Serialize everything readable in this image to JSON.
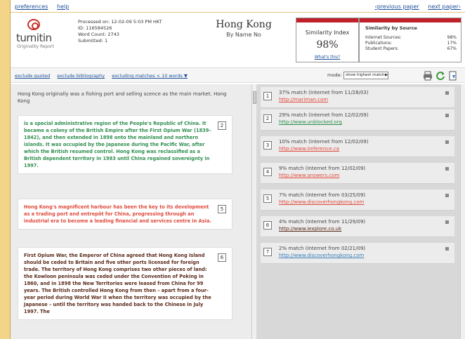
{
  "topbar": {
    "links": [
      "preferences",
      "help"
    ],
    "nav": [
      "‹previous paper",
      "next paper›"
    ]
  },
  "header": {
    "logo_text": "turnitin",
    "logo_sub": "Originality Report",
    "processed": "Processed on: 12-02-09 5:03 PM HKT",
    "id": "ID: 116584526",
    "word_count": "Word Count: 2743",
    "submitted": "Submitted: 1",
    "title": "Hong Kong",
    "author": "By Name No"
  },
  "similarity_index": {
    "label": "Similarity Index",
    "value": "98%",
    "whats_this": "What's this?"
  },
  "similarity_by_source": {
    "heading": "Similarity by Source",
    "rows": [
      {
        "label": "Internet Sources:",
        "value": "98%"
      },
      {
        "label": "Publications:",
        "value": "17%"
      },
      {
        "label": "Student Papers:",
        "value": "67%"
      }
    ]
  },
  "toolbar": {
    "links": [
      "exclude quoted",
      "exclude bibliography",
      "excluding matches < 10 words ▼"
    ],
    "mode_label": "mode:",
    "mode_value": "show highest matches together"
  },
  "document": {
    "intro": "Hong Kong originally was a fishing port and selling scence as the main market. Hong Kong",
    "blocks": [
      {
        "num": "2",
        "color": "#2e8f4f",
        "text": "is a special administrative region of the People's Republic of China. It became a colony of the British Empire after the First Opium War (1839–1842), and then extended in 1898 onto the mainland and northern islands. It was occupied by the Japanese during the Pacific War, after which the British resumed control. Hong Kong was reclassified as a British dependent territory in 1983 until China regained sovereignty in 1997."
      },
      {
        "num": "5",
        "color": "#e04a3c",
        "text": "Hong Kong's magnificent harbour has been the key to its development as a trading port and entrepôt for China, progressing through an industrial era to become a leading financial and services centre in Asia."
      },
      {
        "num": "6",
        "color": "#5a2a1a",
        "text": "First Opium War, the Emperor of China agreed that Hong Kong Island should be ceded to Britain and five other ports licensed for foreign trade. The territory of Hong Kong comprises two other pieces of land: the Kowloon peninsula was ceded under the Convention of Peking in 1860, and in 1898 the New Territories were leased from China for 99 years. The British controlled Hong Kong from then – apart from a four-year period during World War II when the territory was occupied by the Japanese – until the territory was handed back to the Chinese in July 1997. The"
      }
    ]
  },
  "matches": [
    {
      "num": "1",
      "text": "37% match (Internet from 11/28/03)",
      "url": "http://mariman.com",
      "color": "#e04a3c"
    },
    {
      "num": "2",
      "text": "29% match (Internet from 12/02/09)",
      "url": "http://www.unblocked.org",
      "color": "#2e8f4f"
    },
    {
      "num": "3",
      "text": "10% match (Internet from 12/02/09)",
      "url": "http://www.ireference.ca",
      "color": "#e04a3c"
    },
    {
      "num": "4",
      "text": "9% match (Internet from 12/02/09)",
      "url": "http://www.answers.com",
      "color": "#e04a3c"
    },
    {
      "num": "5",
      "text": "7% match (Internet from 03/25/09)",
      "url": "http://www.discoverhongkong.com",
      "color": "#e04a3c"
    },
    {
      "num": "6",
      "text": "4% match (Internet from 11/29/09)",
      "url": "http://www.iexplore.co.uk",
      "color": "#5a2a1a"
    },
    {
      "num": "7",
      "text": "2% match (Internet from 02/21/09)",
      "url": "http://www.discoverhongkong.com",
      "color": "#3a7fb8"
    }
  ]
}
